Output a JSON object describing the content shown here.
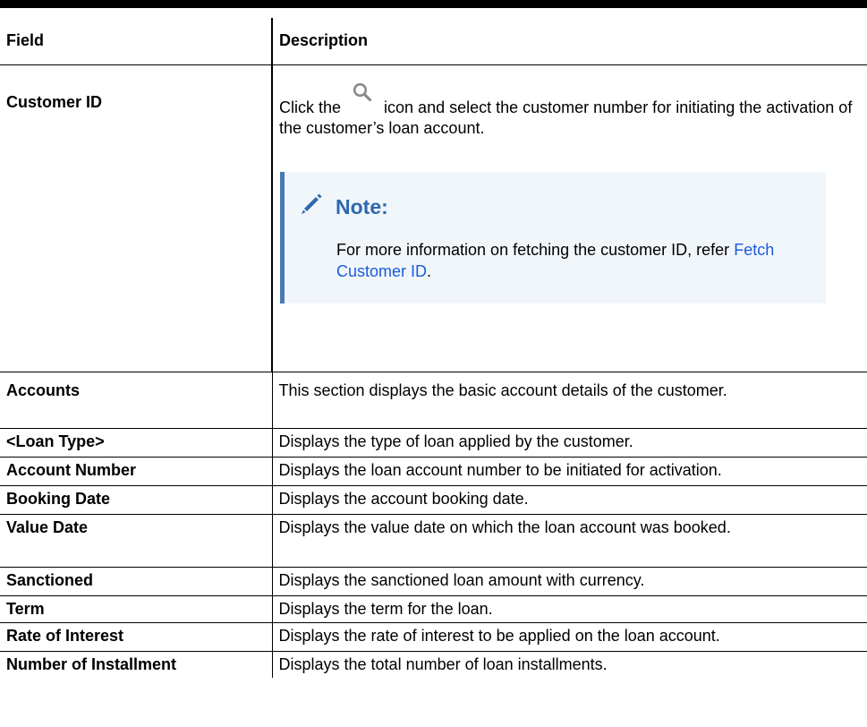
{
  "header": {
    "field": "Field",
    "description": "Description"
  },
  "customer_row": {
    "field": "Customer ID",
    "desc_before_icon": "Click the",
    "icon": "search-icon",
    "desc_after_icon": "icon and select the customer number for initiating the activation of the customer’s loan account.",
    "note": {
      "icon": "pencil-icon",
      "title": "Note:",
      "text": "For more information on fetching the customer ID, refer",
      "link": "Fetch Customer ID",
      "text_end": "."
    }
  },
  "rows": [
    {
      "field": "Accounts",
      "description": "This section displays the basic account details of the customer."
    },
    {
      "field": "<Loan Type>",
      "description": "Displays the type of loan applied by the customer."
    },
    {
      "field": "Account Number",
      "description": "Displays the loan account number to be initiated for activation."
    },
    {
      "field": "Booking Date",
      "description": "Displays the account booking date."
    },
    {
      "field": "Value Date",
      "description": "Displays the value date on which the loan account was booked."
    },
    {
      "field": "Sanctioned",
      "description": "Displays the sanctioned loan amount with currency."
    },
    {
      "field": "Term",
      "description": "Displays the term for the loan."
    },
    {
      "field": "Rate of Interest",
      "description": "Displays the rate of interest to be applied on the loan account."
    },
    {
      "field": "Number of Installment",
      "description": "Displays the total number of loan installments."
    }
  ],
  "colors": {
    "note_background": "#f1f6fb",
    "note_accent": "#4a7ab5",
    "note_title": "#2d68b0",
    "link": "#1a5adb"
  }
}
